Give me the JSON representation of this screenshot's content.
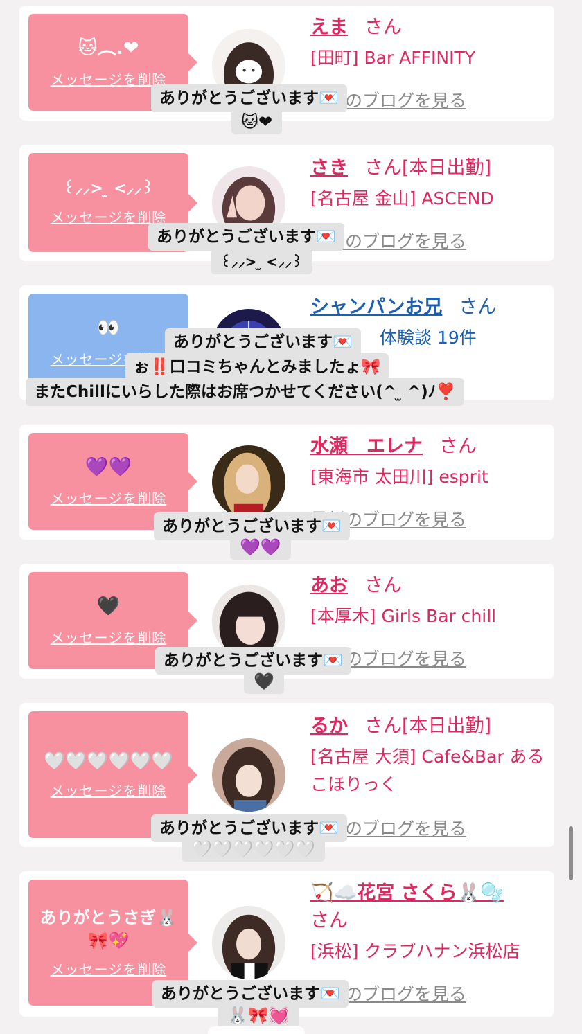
{
  "delete_label": "メッセージを削除",
  "blog_label": "最新のブログを見る",
  "san": "さん",
  "cards": [
    {
      "bubble_msg": "🐱︵.❤",
      "name": "えま",
      "suffix": "",
      "shop": "[田町] Bar AFFINITY",
      "tip": [
        "ありがとうございます💌",
        "🐱❤"
      ]
    },
    {
      "bubble_msg": "꒰⸝⸝> ̫ <⸝⸝꒱",
      "name": "さき",
      "suffix": "[本日出勤]",
      "shop": "[名古屋 金山] ASCEND",
      "tip": [
        "ありがとうございます💌",
        "꒰⸝⸝> ̫ <⸝⸝꒱"
      ]
    },
    {
      "bubble_msg": "👀",
      "name": "シャンパンお兄",
      "suffix": "",
      "shop": "体験談 19件",
      "tip": [
        "ありがとうございます💌",
        "ぉ‼️口コミちゃんとみましたょ🎀",
        "またChillにいらした際はお席つかせてください(^ ̫ ^)ﾉ❣️"
      ]
    },
    {
      "bubble_msg": "💜💜",
      "name": "水瀬　エレナ",
      "suffix": "",
      "shop": "[東海市 太田川] esprit",
      "tip": [
        "ありがとうございます💌",
        "💜💜"
      ]
    },
    {
      "bubble_msg": "🖤",
      "name": "あお",
      "suffix": "",
      "shop": "[本厚木] Girls Bar chill",
      "tip": [
        "ありがとうございます💌",
        "🖤"
      ]
    },
    {
      "bubble_msg": "🤍🤍🤍🤍🤍🤍",
      "name": "るか",
      "suffix": "[本日出勤]",
      "shop": "[名古屋 大須] Cafe&Bar あるこほりっく",
      "tip": [
        "ありがとうございます💌",
        "🤍🤍🤍🤍🤍🤍"
      ]
    },
    {
      "bubble_msg": "ありがとうさぎ🐰🎀💖",
      "name": "🏹☁️花宮 さくら🐰🫧",
      "suffix": "",
      "shop": "[浜松] クラブハナン浜松店",
      "tip": [
        "ありがとうございます💌",
        "🐰🎀💓"
      ]
    }
  ],
  "colors": {
    "accent": "#e2265e",
    "bubble_pink": "#f7909f",
    "bubble_blue": "#8ab5ef",
    "link_blue": "#1c5fb3",
    "tooltip_bg": "#e3e3e3"
  }
}
